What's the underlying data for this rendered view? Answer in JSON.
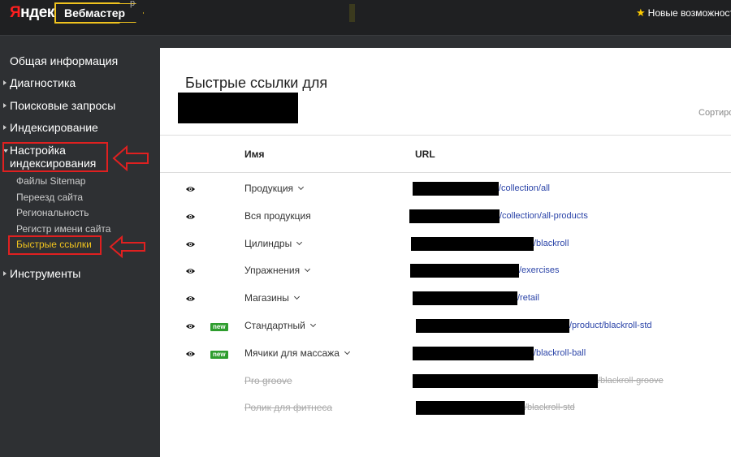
{
  "header": {
    "logo_red": "Я",
    "logo_rest": "ндекс",
    "product": "Вебмастер",
    "superscript": "р",
    "whats_new": "Новые возможности"
  },
  "sidebar": {
    "items": [
      {
        "label": "Общая информация"
      },
      {
        "label": "Диагностика"
      },
      {
        "label": "Поисковые запросы"
      },
      {
        "label": "Индексирование"
      },
      {
        "label_line1": "Настройка",
        "label_line2": "индексирования"
      },
      {
        "label": "Инструменты"
      }
    ],
    "subitems": [
      {
        "label": "Файлы Sitemap"
      },
      {
        "label": "Переезд сайта"
      },
      {
        "label": "Региональность"
      },
      {
        "label": "Регистр имени сайта"
      },
      {
        "label": "Быстрые ссылки"
      }
    ]
  },
  "main": {
    "title": "Быстрые ссылки для",
    "sort_label": "Сортиро",
    "columns": {
      "name": "Имя",
      "url": "URL"
    },
    "rows": [
      {
        "name": "Продукция",
        "url": "/collection/all",
        "visible": true,
        "new": false,
        "disabled": false
      },
      {
        "name": "Вся продукция",
        "url": "/collection/all-products",
        "visible": true,
        "new": false,
        "disabled": false
      },
      {
        "name": "Цилиндры",
        "url": "/blackroll",
        "visible": true,
        "new": false,
        "disabled": false
      },
      {
        "name": "Упражнения",
        "url": "/exercises",
        "visible": true,
        "new": false,
        "disabled": false
      },
      {
        "name": "Магазины",
        "url": "/retail",
        "visible": true,
        "new": false,
        "disabled": false
      },
      {
        "name": "Стандартный",
        "url": "/product/blackroll-std",
        "visible": true,
        "new": true,
        "disabled": false
      },
      {
        "name": "Мячики для массажа",
        "url": "/blackroll-ball",
        "visible": true,
        "new": true,
        "disabled": false
      },
      {
        "name": "Pro groove",
        "url": "/blackroll-groove",
        "visible": false,
        "new": false,
        "disabled": true
      },
      {
        "name": "Ролик для фитнеса",
        "url": "/blackroll-std",
        "visible": false,
        "new": false,
        "disabled": true
      }
    ],
    "new_badge": "new"
  },
  "colors": {
    "accent": "#f0c31e",
    "highlight": "#e02020",
    "link": "#2b44a8",
    "new_badge": "#2e9d2e"
  }
}
